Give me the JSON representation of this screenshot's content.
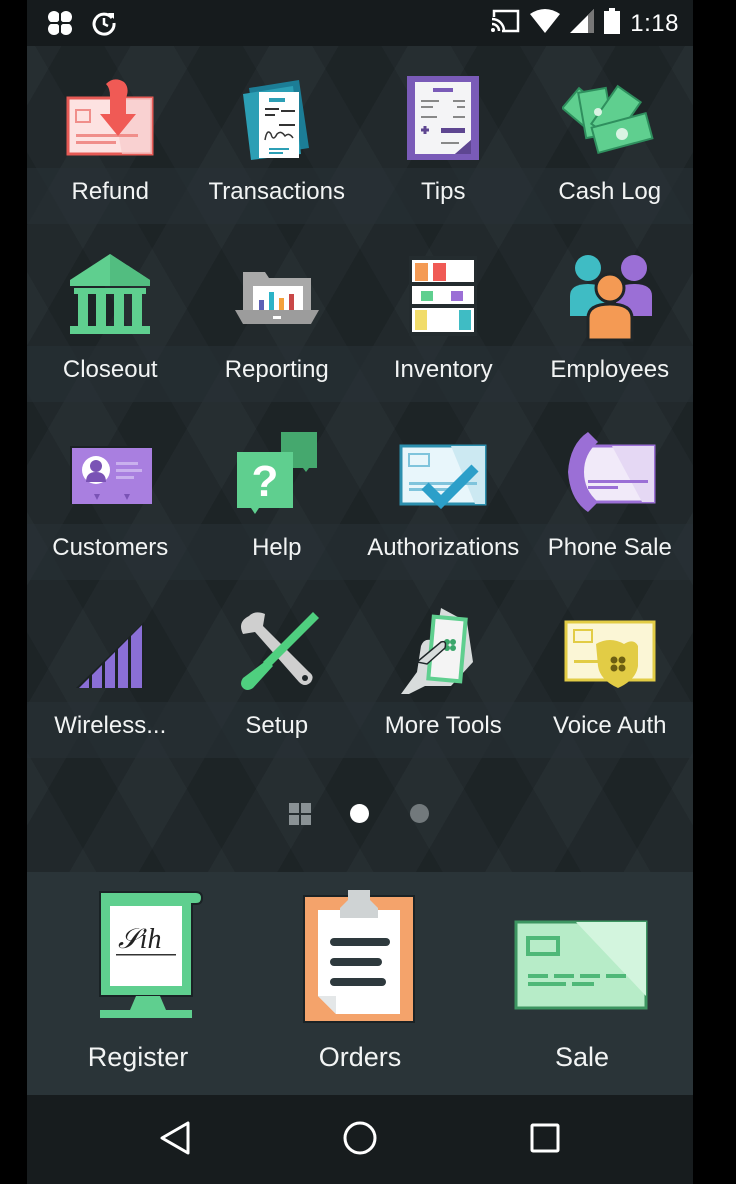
{
  "status_bar": {
    "left_icons": [
      "clover-app-icon",
      "sync-clock-icon"
    ],
    "right_icons": [
      "cast-icon",
      "wifi-icon",
      "cell-signal-icon",
      "battery-icon"
    ],
    "time": "1:18"
  },
  "apps": [
    {
      "label": "Refund",
      "icon": "refund-icon"
    },
    {
      "label": "Transactions",
      "icon": "transactions-icon"
    },
    {
      "label": "Tips",
      "icon": "tips-icon"
    },
    {
      "label": "Cash Log",
      "icon": "cash-log-icon"
    },
    {
      "label": "Closeout",
      "icon": "closeout-icon"
    },
    {
      "label": "Reporting",
      "icon": "reporting-icon"
    },
    {
      "label": "Inventory",
      "icon": "inventory-icon"
    },
    {
      "label": "Employees",
      "icon": "employees-icon"
    },
    {
      "label": "Customers",
      "icon": "customers-icon"
    },
    {
      "label": "Help",
      "icon": "help-icon"
    },
    {
      "label": "Authorizations",
      "icon": "authorizations-icon"
    },
    {
      "label": "Phone Sale",
      "icon": "phone-sale-icon"
    },
    {
      "label": "Wireless...",
      "icon": "wireless-icon"
    },
    {
      "label": "Setup",
      "icon": "setup-icon"
    },
    {
      "label": "More Tools",
      "icon": "more-tools-icon"
    },
    {
      "label": "Voice Auth",
      "icon": "voice-auth-icon"
    }
  ],
  "pager": {
    "pages": 3,
    "current_page": 2,
    "first_is_grid": true
  },
  "dock": [
    {
      "label": "Register",
      "icon": "register-icon"
    },
    {
      "label": "Orders",
      "icon": "orders-icon"
    },
    {
      "label": "Sale",
      "icon": "sale-icon"
    }
  ],
  "nav_bar": {
    "back": "back-icon",
    "home": "home-icon",
    "recents": "recents-icon"
  },
  "colors": {
    "green": "#5fcf8f",
    "purple": "#9b6fd6",
    "red": "#f05a55",
    "teal": "#2c9fb5",
    "orange": "#f4a36b",
    "yellow": "#f1dc6a"
  }
}
